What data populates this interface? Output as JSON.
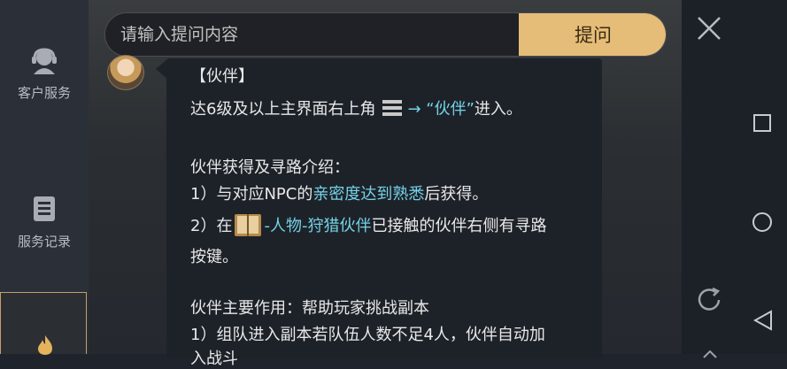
{
  "sidebar": {
    "items": [
      {
        "label": "客户服务",
        "icon": "customer-service-icon"
      },
      {
        "label": "服务记录",
        "icon": "service-record-icon"
      }
    ]
  },
  "search": {
    "placeholder": "请输入提问内容",
    "button_label": "提问"
  },
  "message": {
    "title": "【伙伴】",
    "entry_prefix": "达6级及以上主界面右上角",
    "entry_arrow_text": "→ “伙伴”",
    "entry_suffix": "进入。",
    "section1_title": "伙伴获得及寻路介绍：",
    "item1_prefix": "1）与对应NPC的",
    "item1_highlight": "亲密度达到熟悉",
    "item1_suffix": "后获得。",
    "item2_prefix": "2）在",
    "item2_highlight": "-人物-狩猎伙伴",
    "item2_suffix": "已接触的伙伴右侧有寻路",
    "item2_cont": "按键。",
    "section2_title": "伙伴主要作用：帮助玩家挑战副本",
    "item3": "1）组队进入副本若队伍人数不足4人，伙伴自动加",
    "item3_cont": "入战斗"
  },
  "colors": {
    "accent_gold": "#e5bd78",
    "pink": "#d89ce7",
    "cyan": "#74d2e6"
  }
}
